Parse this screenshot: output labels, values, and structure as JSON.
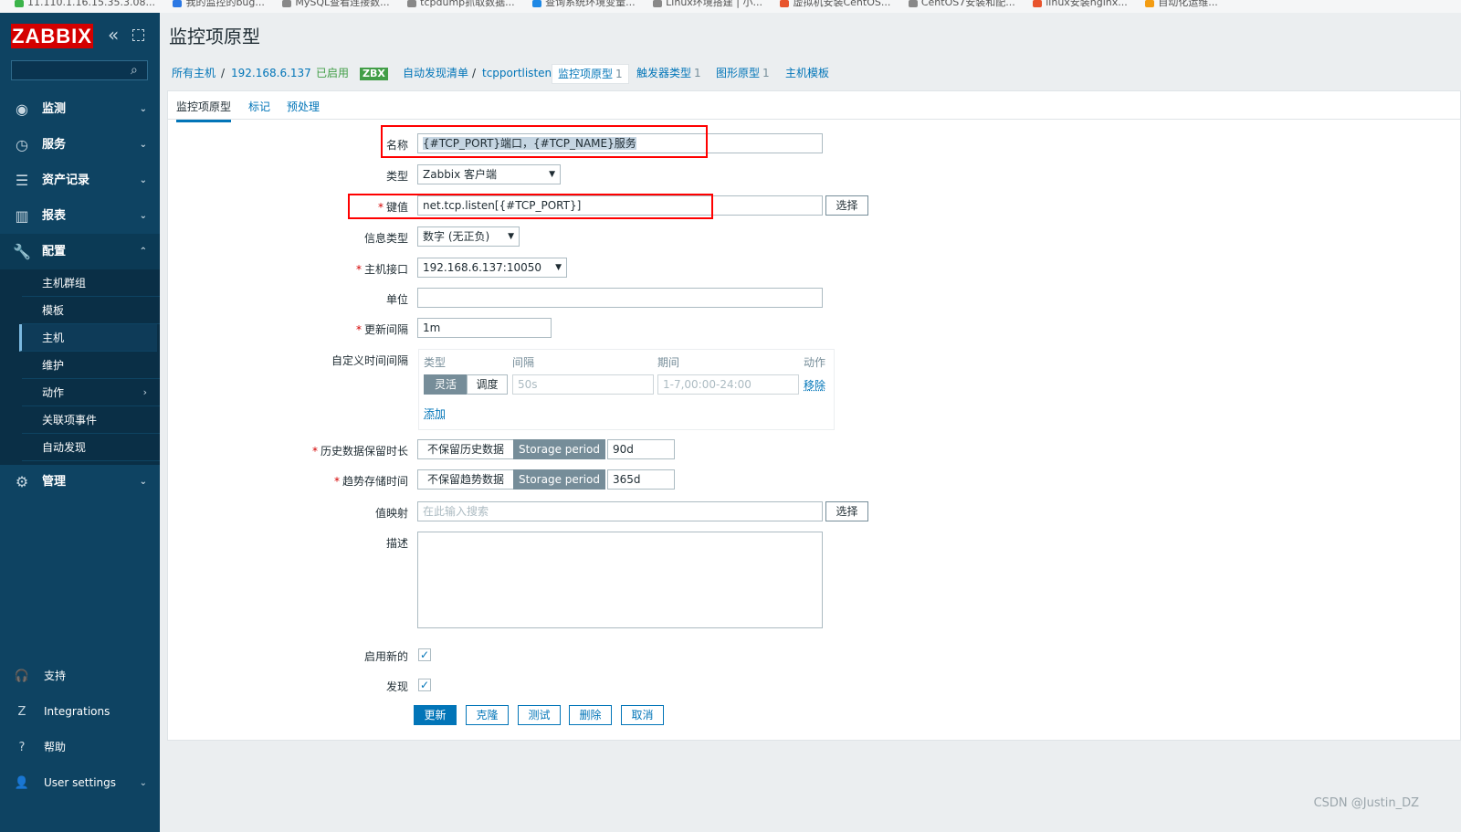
{
  "bookmarks": [
    "11.110.1.16.15.35.3.08...",
    "我的监控的bug...",
    "MySQL查看连接数...",
    "tcpdump抓取数据...",
    "查询系统环境变量...",
    "Linux环境搭建 | 小...",
    "虚拟机安装CentOS...",
    "CentOS7安装和配...",
    "linux安装nginx...",
    "自动化运维..."
  ],
  "sidebar": {
    "logo": "ZABBIX",
    "collapse_icon": "«",
    "search_icon": "⌕",
    "nav": [
      {
        "icon": "◉",
        "label": "监测"
      },
      {
        "icon": "◷",
        "label": "服务"
      },
      {
        "icon": "☰",
        "label": "资产记录"
      },
      {
        "icon": "▥",
        "label": "报表"
      },
      {
        "icon": "🔧",
        "label": "配置"
      }
    ],
    "submenu": [
      "主机群组",
      "模板",
      "主机",
      "维护",
      "动作",
      "关联项事件",
      "自动发现"
    ],
    "admin": {
      "icon": "⚙",
      "label": "管理"
    },
    "bottom": [
      {
        "icon": "🎧",
        "label": "支持"
      },
      {
        "icon": "Z",
        "label": "Integrations"
      },
      {
        "icon": "?",
        "label": "帮助"
      },
      {
        "icon": "👤",
        "label": "User settings"
      }
    ]
  },
  "header": {
    "title": "监控项原型"
  },
  "breadcrumbs": {
    "all_hosts": "所有主机",
    "sep": "/",
    "host": "192.168.6.137",
    "enabled": "已启用",
    "zbx": "ZBX",
    "discovery_list": "自动发现清单",
    "rule": "tcpportlisten",
    "item_proto": "监控项原型",
    "item_proto_count": "1",
    "trigger_proto": "触发器类型",
    "trigger_proto_count": "1",
    "graph_proto": "图形原型",
    "graph_proto_count": "1",
    "host_proto": "主机模板"
  },
  "tabs": [
    "监控项原型",
    "标记",
    "预处理"
  ],
  "form": {
    "name_label": "名称",
    "name_value": "{#TCP_PORT}端口，{#TCP_NAME}服务",
    "type_label": "类型",
    "type_value": "Zabbix 客户端",
    "key_label": "键值",
    "key_value": "net.tcp.listen[{#TCP_PORT}]",
    "select_btn": "选择",
    "info_type_label": "信息类型",
    "info_type_value": "数字 (无正负)",
    "interface_label": "主机接口",
    "interface_value": "192.168.6.137:10050",
    "units_label": "单位",
    "units_value": "",
    "interval_label": "更新间隔",
    "interval_value": "1m",
    "custom_intervals_label": "自定义时间间隔",
    "ci_headers": {
      "type": "类型",
      "interval": "间隔",
      "period": "期间",
      "action": "动作"
    },
    "ci_flexible": "灵活",
    "ci_scheduling": "调度",
    "ci_interval_placeholder": "50s",
    "ci_period_placeholder": "1-7,00:00-24:00",
    "ci_remove": "移除",
    "ci_add": "添加",
    "history_label": "历史数据保留时长",
    "history_off": "不保留历史数据",
    "history_on": "Storage period",
    "history_value": "90d",
    "trends_label": "趋势存储时间",
    "trends_off": "不保留趋势数据",
    "trends_on": "Storage period",
    "trends_value": "365d",
    "valuemap_label": "值映射",
    "valuemap_placeholder": "在此输入搜索",
    "desc_label": "描述",
    "create_enabled_label": "启用新的",
    "discover_label": "发现",
    "check": "✓"
  },
  "buttons": {
    "update": "更新",
    "clone": "克隆",
    "test": "测试",
    "delete": "删除",
    "cancel": "取消"
  },
  "watermark": "CSDN @Justin_DZ"
}
